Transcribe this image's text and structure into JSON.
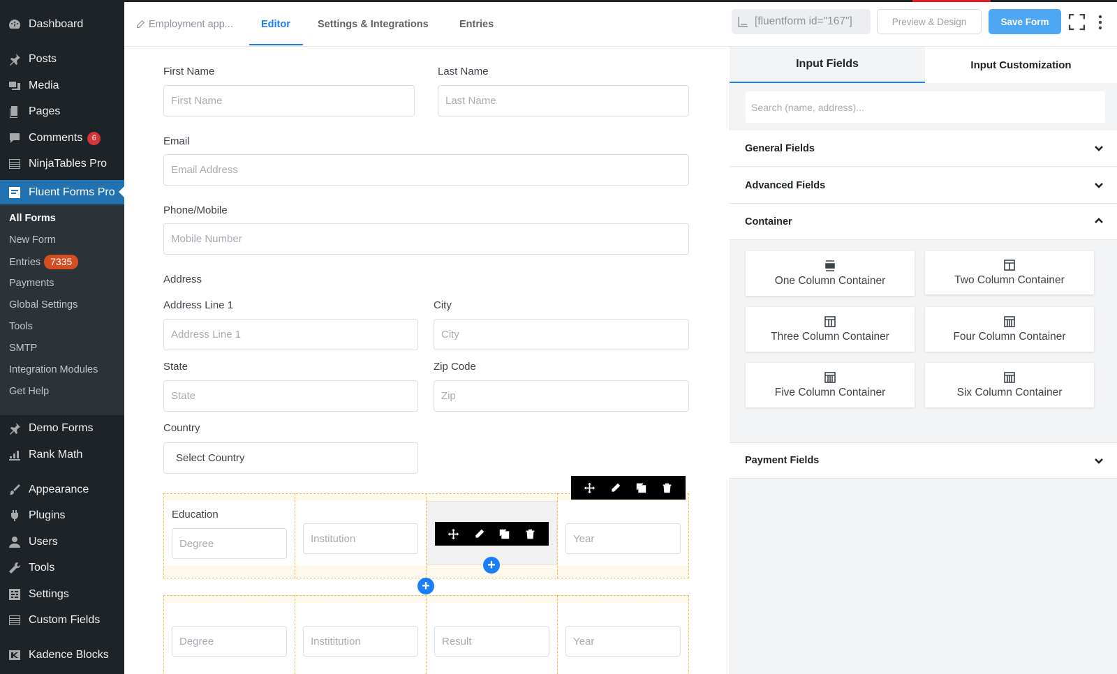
{
  "sidebar": {
    "items": [
      {
        "label": "Dashboard",
        "icon": "dashboard-icon"
      },
      {
        "label": "Posts",
        "icon": "pin-icon"
      },
      {
        "label": "Media",
        "icon": "media-icon"
      },
      {
        "label": "Pages",
        "icon": "pages-icon"
      },
      {
        "label": "Comments",
        "icon": "comment-icon",
        "badge": "6"
      },
      {
        "label": "NinjaTables Pro",
        "icon": "table-icon"
      },
      {
        "label": "Fluent Forms Pro",
        "icon": "fluent-forms-icon"
      },
      {
        "label": "Demo Forms",
        "icon": "pin-icon"
      },
      {
        "label": "Rank Math",
        "icon": "chart-icon"
      },
      {
        "label": "Appearance",
        "icon": "paintbrush-icon"
      },
      {
        "label": "Plugins",
        "icon": "plug-icon"
      },
      {
        "label": "Users",
        "icon": "user-icon"
      },
      {
        "label": "Tools",
        "icon": "wrench-icon"
      },
      {
        "label": "Settings",
        "icon": "settings-icon"
      },
      {
        "label": "Custom Fields",
        "icon": "table-icon"
      },
      {
        "label": "Kadence Blocks",
        "icon": "kadence-icon"
      }
    ],
    "submenu": [
      {
        "label": "All Forms"
      },
      {
        "label": "New Form"
      },
      {
        "label": "Entries",
        "badge": "7335"
      },
      {
        "label": "Payments"
      },
      {
        "label": "Global Settings"
      },
      {
        "label": "Tools"
      },
      {
        "label": "SMTP"
      },
      {
        "label": "Integration Modules"
      },
      {
        "label": "Get Help"
      }
    ]
  },
  "header": {
    "form_name": "Employment app...",
    "tabs": [
      "Editor",
      "Settings & Integrations",
      "Entries"
    ],
    "shortcode": "[fluentform id=\"167\"]",
    "preview_label": "Preview & Design",
    "save_label": "Save Form"
  },
  "form": {
    "first_name": {
      "label": "First Name",
      "placeholder": "First Name"
    },
    "last_name": {
      "label": "Last Name",
      "placeholder": "Last Name"
    },
    "email": {
      "label": "Email",
      "placeholder": "Email Address"
    },
    "phone": {
      "label": "Phone/Mobile",
      "placeholder": "Mobile Number"
    },
    "address": {
      "label": "Address",
      "line1": {
        "label": "Address Line 1",
        "placeholder": "Address Line 1"
      },
      "city": {
        "label": "City",
        "placeholder": "City"
      },
      "state": {
        "label": "State",
        "placeholder": "State"
      },
      "zip": {
        "label": "Zip Code",
        "placeholder": "Zip"
      },
      "country": {
        "label": "Country",
        "value": "Select Country"
      }
    },
    "education_row1": {
      "label": "Education",
      "fields": [
        "Degree",
        "Institution",
        "Year"
      ]
    },
    "education_row2": {
      "fields": [
        "Degree",
        "Instititution",
        "Result",
        "Year"
      ]
    }
  },
  "panel": {
    "tabs": [
      "Input Fields",
      "Input Customization"
    ],
    "search_placeholder": "Search (name, address)...",
    "sections": [
      "General Fields",
      "Advanced Fields",
      "Container",
      "Payment Fields"
    ],
    "containers": [
      "One Column Container",
      "Two Column Container",
      "Three Column Container",
      "Four Column Container",
      "Five Column Container",
      "Six Column Container"
    ]
  }
}
